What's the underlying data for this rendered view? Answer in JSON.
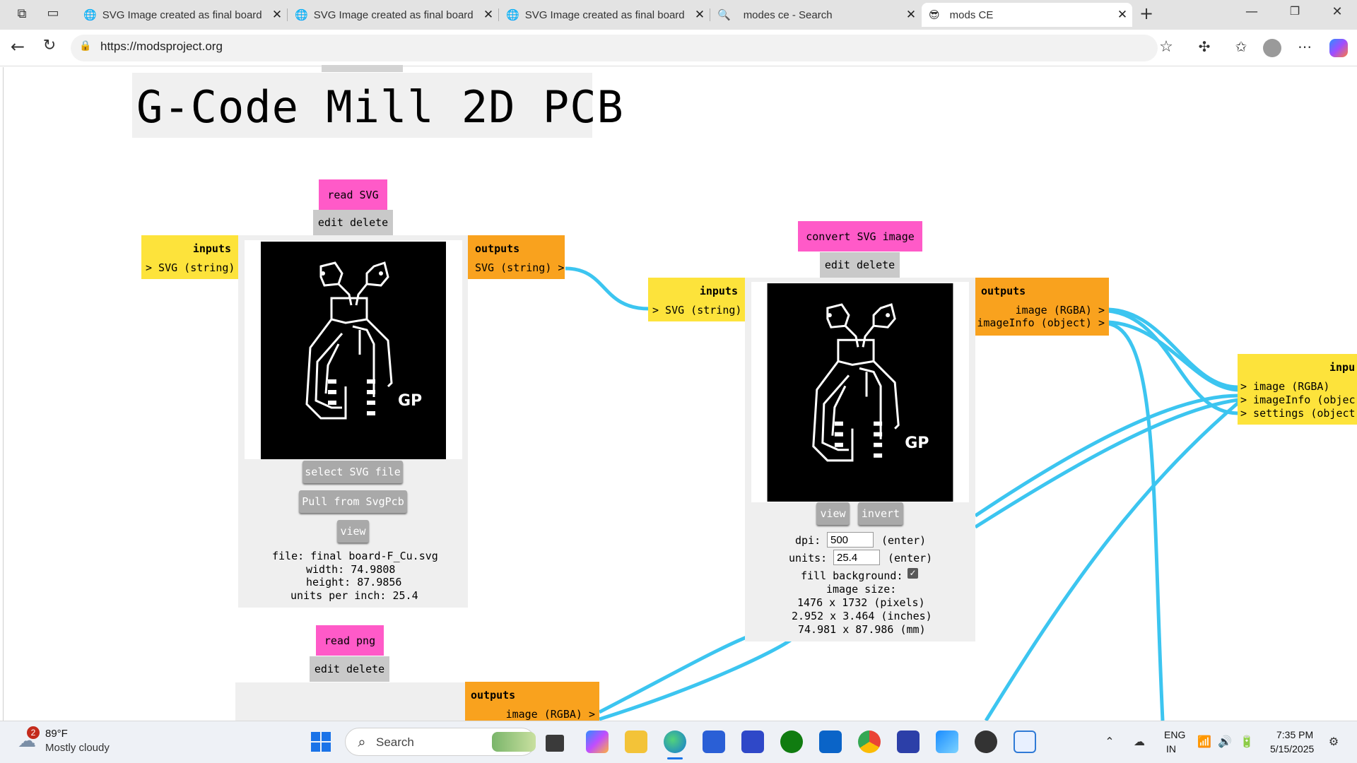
{
  "browser": {
    "tabs": [
      {
        "label": "SVG Image created as final board"
      },
      {
        "label": "SVG Image created as final board"
      },
      {
        "label": "SVG Image created as final board"
      },
      {
        "label": "modes ce - Search"
      },
      {
        "label": "mods CE"
      }
    ],
    "url": "https://modsproject.org"
  },
  "page": {
    "title": "G-Code Mill 2D PCB",
    "read_svg": {
      "name": "read SVG",
      "controls": "edit delete",
      "inputs_header": "inputs",
      "input_1": "> SVG (string)",
      "outputs_header": "outputs",
      "output_1": "SVG (string) >",
      "btn_select": "select SVG file",
      "btn_pull": "Pull from SvgPcb",
      "btn_view": "view",
      "file": "file: final board-F_Cu.svg",
      "width": "width: 74.9808",
      "height": "height: 87.9856",
      "units": "units per inch: 25.4"
    },
    "convert_svg": {
      "name": "convert SVG image",
      "controls": "edit delete",
      "inputs_header": "inputs",
      "input_1": "> SVG (string)",
      "outputs_header": "outputs",
      "output_1": "image (RGBA) >",
      "output_2": "imageInfo (object) >",
      "btn_view": "view",
      "btn_invert": "invert",
      "dpi_label": "dpi:",
      "dpi_value": "500",
      "dpi_enter": "(enter)",
      "units_label": "units:",
      "units_value": "25.4",
      "units_enter": "(enter)",
      "fill_label": "fill background:",
      "size_label": "image size:",
      "size_px": "1476 x 1732 (pixels)",
      "size_in": "2.952 x 3.464 (inches)",
      "size_mm": "74.981 x 87.986 (mm)"
    },
    "right_module": {
      "inputs_header": "inpu",
      "input_1": "> image (RGBA)",
      "input_2": "> imageInfo (objec",
      "input_3": "> settings (object"
    },
    "read_png": {
      "name": "read png",
      "controls": "edit delete",
      "outputs_header": "outputs",
      "output_1": "image (RGBA) >"
    },
    "pcb_text": "GP"
  },
  "taskbar": {
    "weather_temp": "89°F",
    "weather_desc": "Mostly cloudy",
    "weather_badge": "2",
    "search": "Search",
    "lang_1": "ENG",
    "lang_2": "IN",
    "time": "7:35 PM",
    "date": "5/15/2025"
  },
  "colors": {
    "wire": "#3cc5f0",
    "module_name": "#ff5ac8",
    "inputs": "#fde33b",
    "outputs": "#f9a21e"
  }
}
